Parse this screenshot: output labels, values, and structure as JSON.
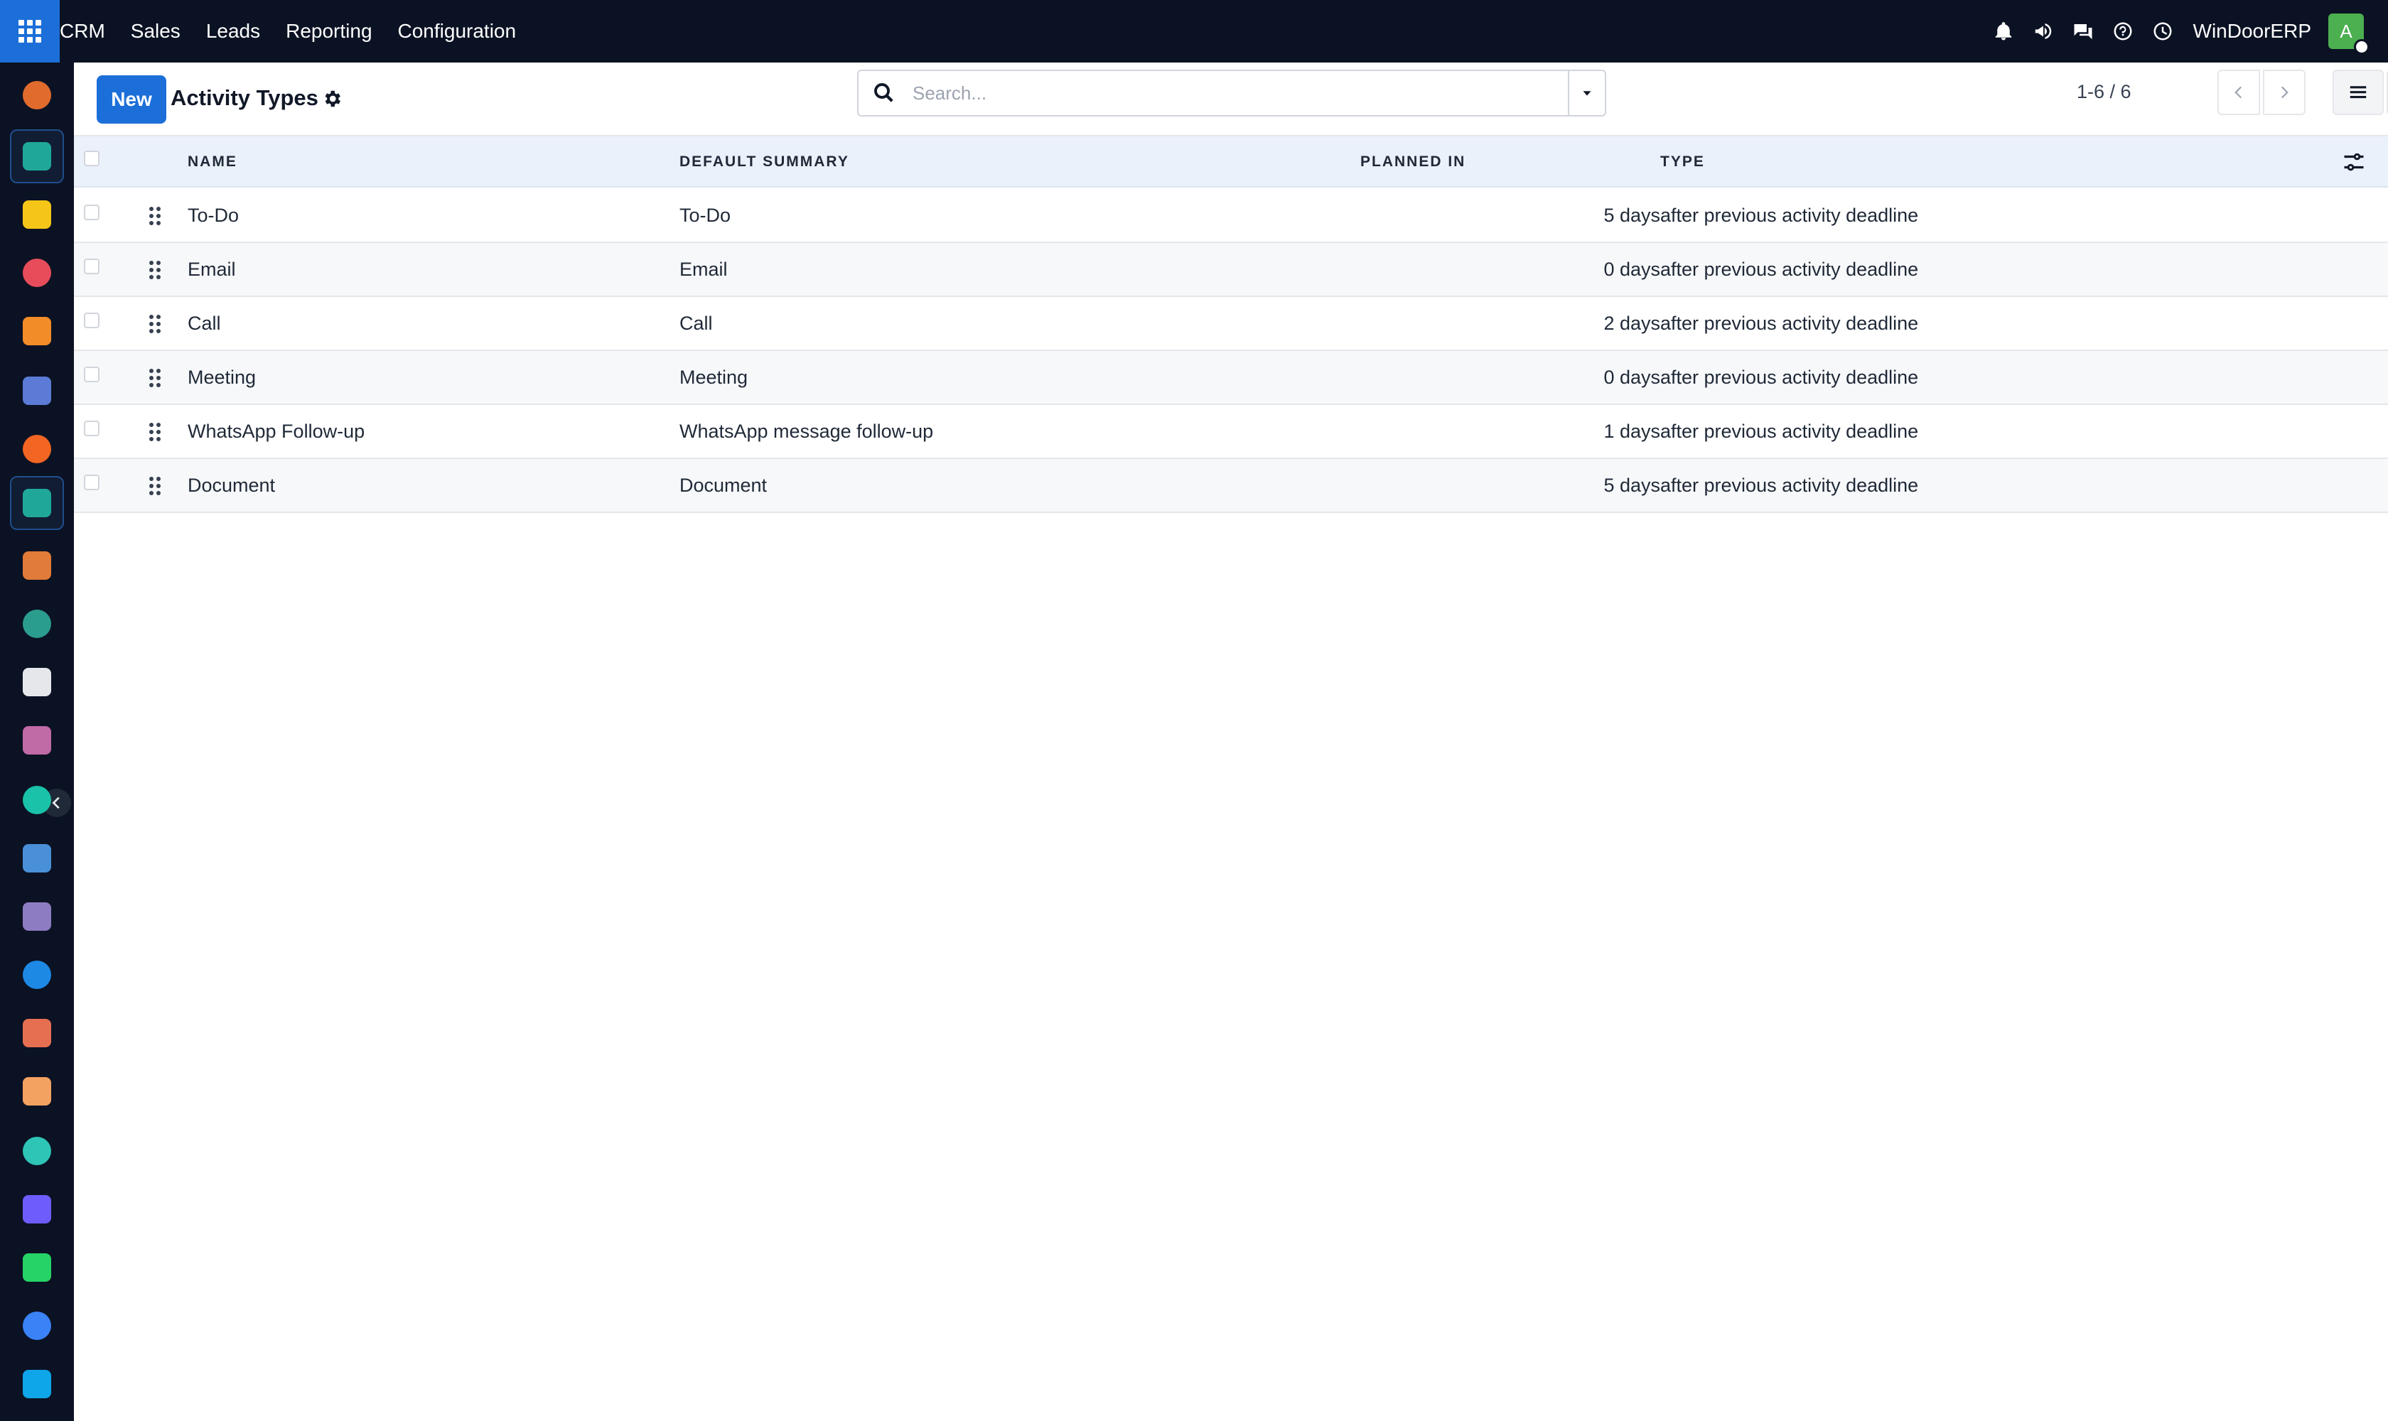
{
  "topbar": {
    "app_name": "CRM",
    "menu": [
      "Sales",
      "Leads",
      "Reporting",
      "Configuration"
    ],
    "company": "WinDoorERP",
    "avatar_letter": "A",
    "icons": [
      "bell-icon",
      "megaphone-icon",
      "chat-icon",
      "help-icon",
      "clock-icon"
    ]
  },
  "sidebar": {
    "apps": [
      {
        "name": "app-1",
        "color": "#e06b2d"
      },
      {
        "name": "crm",
        "color": "#1fa89a",
        "active": true
      },
      {
        "name": "email-marketing",
        "color": "#f5c518"
      },
      {
        "name": "dashboards",
        "color": "#e74c5b"
      },
      {
        "name": "app-5",
        "color": "#f28c28"
      },
      {
        "name": "mail",
        "color": "#5b7bd6"
      },
      {
        "name": "live-chat",
        "color": "#f26522"
      },
      {
        "name": "crm-2",
        "color": "#1fa89a",
        "active": true
      },
      {
        "name": "reporting",
        "color": "#e07b39"
      },
      {
        "name": "contacts",
        "color": "#2a9d8f"
      },
      {
        "name": "inventory",
        "color": "#e5e7eb"
      },
      {
        "name": "knowledge",
        "color": "#c06aa6"
      },
      {
        "name": "project",
        "color": "#19c2a8"
      },
      {
        "name": "documents",
        "color": "#4a90d9"
      },
      {
        "name": "product",
        "color": "#8e7cc3"
      },
      {
        "name": "invoicing",
        "color": "#1e88e5"
      },
      {
        "name": "employees",
        "color": "#e76f51"
      },
      {
        "name": "calendar",
        "color": "#f4a261"
      },
      {
        "name": "sign",
        "color": "#2ec4b6"
      },
      {
        "name": "dashboard-2",
        "color": "#6d5dfc"
      },
      {
        "name": "whatsapp",
        "color": "#25d366"
      },
      {
        "name": "timesheet",
        "color": "#3b82f6"
      },
      {
        "name": "discuss",
        "color": "#0ea5e9"
      }
    ]
  },
  "control_panel": {
    "new_label": "New",
    "title": "Activity Types",
    "search_placeholder": "Search...",
    "pager": "1-6 / 6"
  },
  "table": {
    "columns": [
      "NAME",
      "DEFAULT SUMMARY",
      "PLANNED IN",
      "TYPE"
    ],
    "rows": [
      {
        "name": "To-Do",
        "summary": "To-Do",
        "planned": "5 days",
        "type": "after previous activity deadline"
      },
      {
        "name": "Email",
        "summary": "Email",
        "planned": "0 days",
        "type": "after previous activity deadline"
      },
      {
        "name": "Call",
        "summary": "Call",
        "planned": "2 days",
        "type": "after previous activity deadline"
      },
      {
        "name": "Meeting",
        "summary": "Meeting",
        "planned": "0 days",
        "type": "after previous activity deadline"
      },
      {
        "name": "WhatsApp Follow-up",
        "summary": "WhatsApp message follow-up",
        "planned": "1 days",
        "type": "after previous activity deadline"
      },
      {
        "name": "Document",
        "summary": "Document",
        "planned": "5 days",
        "type": "after previous activity deadline"
      }
    ]
  }
}
